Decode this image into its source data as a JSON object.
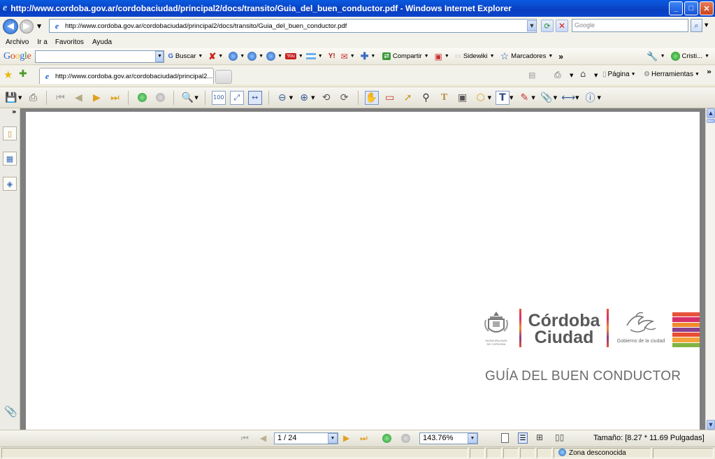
{
  "window": {
    "title": "http://www.cordoba.gov.ar/cordobaciudad/principal2/docs/transito/Guia_del_buen_conductor.pdf - Windows Internet Explorer"
  },
  "address": {
    "url": "http://www.cordoba.gov.ar/cordobaciudad/principal2/docs/transito/Guia_del_buen_conductor.pdf",
    "search_placeholder": "Google"
  },
  "menu": [
    "Archivo",
    "Ir a",
    "Favoritos",
    "Ayuda"
  ],
  "google_toolbar": {
    "logo": "Google",
    "search_btn": "Buscar",
    "share": "Compartir",
    "sidewiki": "Sidewiki",
    "bookmarks": "Marcadores",
    "more": "»",
    "user": "Cristi..."
  },
  "tabs": {
    "active_label": "http://www.cordoba.gov.ar/cordobaciudad/principal2...",
    "page_menu": "Página",
    "tools_menu": "Herramientas"
  },
  "pdf": {
    "logo_line1": "Córdoba",
    "logo_line2": "Ciudad",
    "muni_text_1": "MUNICIPALIDAD",
    "muni_text_2": "DE CORDOBA",
    "gov_text": "Gobierno de la ciudad",
    "doc_title": "GUÍA DEL BUEN CONDUCTOR",
    "stripe_colors": [
      "#e8533c",
      "#d62f6b",
      "#f08c2c",
      "#8a3f8f",
      "#e94d32",
      "#f3a33a",
      "#7fb541"
    ]
  },
  "navbar": {
    "page": "1 / 24",
    "zoom": "143.76%",
    "size": "Tamaño: [8.27 * 11.69 Pulgadas]"
  },
  "status": {
    "zone": "Zona desconocida"
  }
}
